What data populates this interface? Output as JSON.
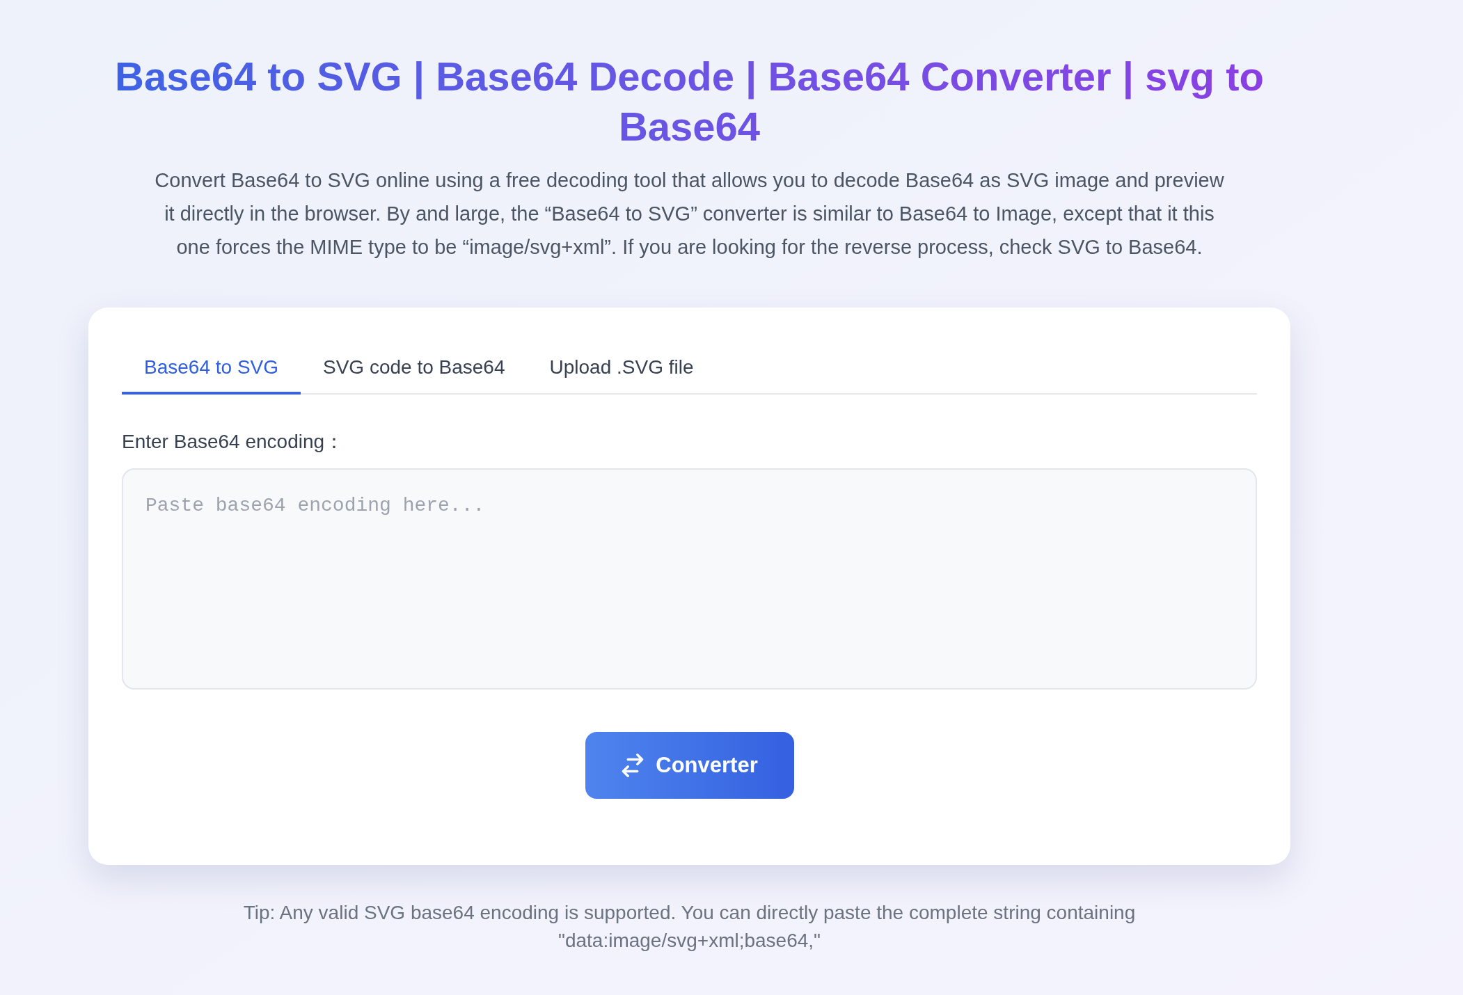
{
  "header": {
    "title": "Base64 to SVG | Base64 Decode | Base64 Converter | svg to Base64",
    "description": "Convert Base64 to SVG online using a free decoding tool that allows you to decode Base64 as SVG image and preview it directly in the browser. By and large, the “Base64 to SVG” converter is similar to Base64 to Image, except that it this one forces the MIME type to be “image/svg+xml”. If you are looking for the reverse process, check SVG to Base64."
  },
  "tabs": [
    {
      "label": "Base64 to SVG",
      "selected": true
    },
    {
      "label": "SVG code to Base64",
      "selected": false
    },
    {
      "label": "Upload .SVG file",
      "selected": false
    }
  ],
  "form": {
    "label": "Enter Base64 encoding：",
    "input": {
      "placeholder": "Paste base64 encoding here..."
    },
    "button": {
      "label": "Converter"
    }
  },
  "tip": "Tip: Any valid SVG base64 encoding is supported. You can directly paste the complete string containing \"data:image/svg+xml;base64,\""
}
